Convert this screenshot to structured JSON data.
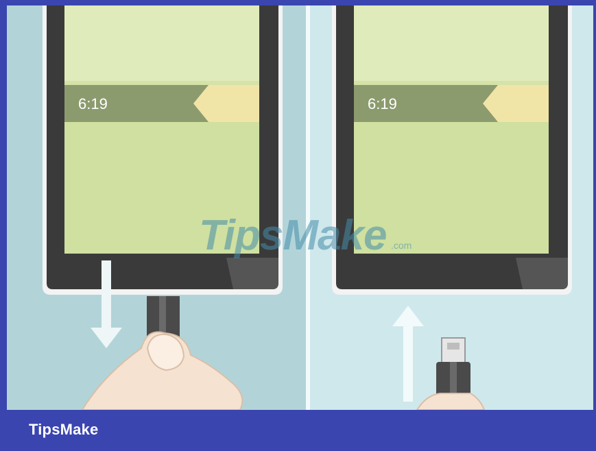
{
  "brand": "TipsMake",
  "watermark": {
    "main": "TipsMake",
    "suffix": ".com"
  },
  "left_phone": {
    "clock": "6:19",
    "action": "unplug cable (arrow down)"
  },
  "right_phone": {
    "clock": "6:19",
    "action": "plug cable (arrow up)"
  },
  "colors": {
    "frame": "#3a45b0",
    "left_bg": "#b2d4d9",
    "right_bg": "#cfe8ec",
    "screen": "#d5e2a8",
    "screen_band": "#8c9b6e",
    "slider_tab": "#f1e4a7",
    "phone_body": "#3a3a3a",
    "skin": "#f6e2d0"
  }
}
